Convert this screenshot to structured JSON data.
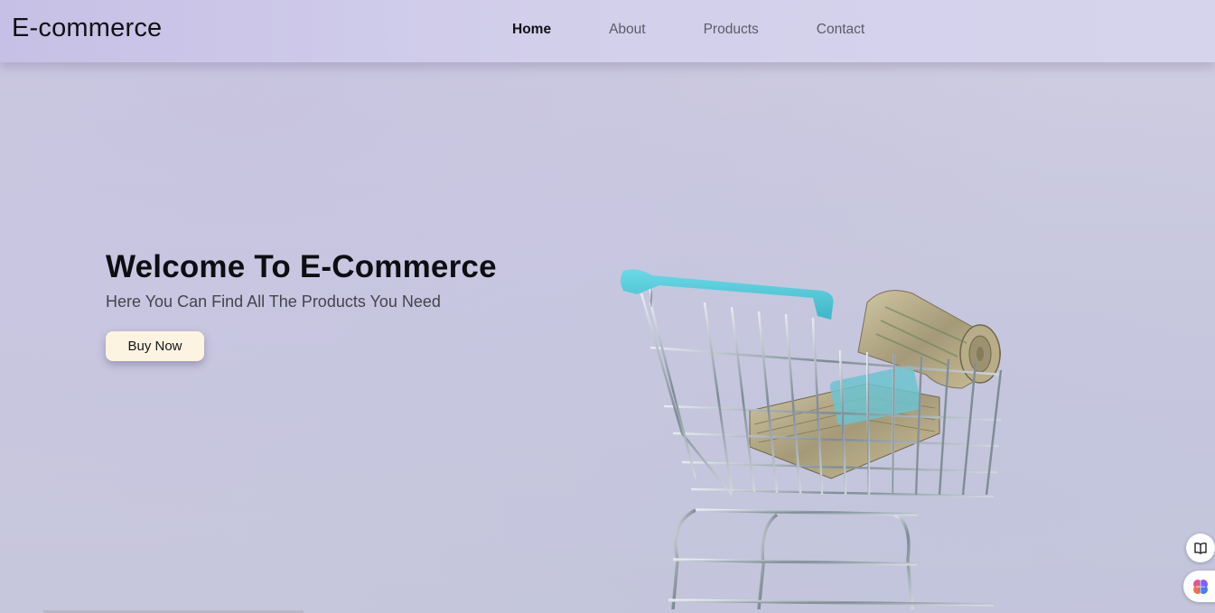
{
  "brand": {
    "title": "E-commerce"
  },
  "nav": {
    "items": [
      {
        "label": "Home",
        "active": true
      },
      {
        "label": "About",
        "active": false
      },
      {
        "label": "Products",
        "active": false
      },
      {
        "label": "Contact",
        "active": false
      }
    ]
  },
  "hero": {
    "title": "Welcome To E-Commerce",
    "subtitle": "Here You Can Find All The Products You Need",
    "cta_label": "Buy Now",
    "image": "shopping-cart-with-money"
  },
  "floating": {
    "book_icon": "book-icon",
    "brain_icon": "brain-icon"
  },
  "colors": {
    "nav_bg": "#d2cfeb",
    "page_bg": "#cbcadf",
    "cta_bg": "#fdf3e1",
    "cart_handle": "#4fc6d6"
  }
}
